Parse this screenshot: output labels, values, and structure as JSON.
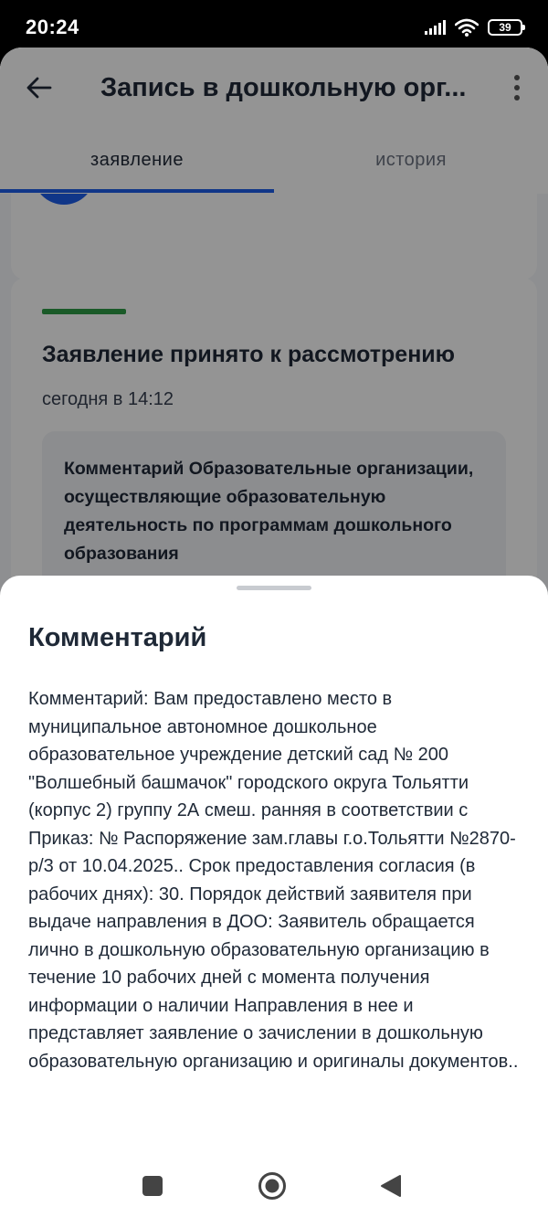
{
  "status_bar": {
    "time": "20:24",
    "battery": "39",
    "icons": [
      "signal-icon",
      "wifi-icon",
      "battery-icon"
    ]
  },
  "app": {
    "title": "Запись в дошкольную орг...",
    "tabs": [
      {
        "label": "заявление",
        "active": true
      },
      {
        "label": "история",
        "active": false
      }
    ],
    "accent_color": "#1d5deb",
    "status_card": {
      "heading": "Заявление принято к рассмотрению",
      "time": "сегодня в 14:12",
      "status_color": "#2e9b46",
      "comment_preview": "Комментарий Образовательные организации, осуществляющие образовательную деятельность по программам дошкольного образования"
    }
  },
  "sheet": {
    "title": "Комментарий",
    "body": "Комментарий: Вам предоставлено место в муниципальное автономное дошкольное образовательное учреждение детский сад № 200 \"Волшебный башмачок\" городского округа Тольятти (корпус 2) группу 2А смеш. ранняя в соответствии с Приказ: № Распоряжение зам.главы г.о.Тольятти №2870-р/3 от 10.04.2025.. Срок предоставления согласия (в рабочих днях): 30. Порядок действий заявителя при выдаче направления в ДОО: Заявитель обращается лично в дошкольную образовательную организацию в течение 10 рабочих дней с момента получения информации о наличии Направления в нее и представляет заявление о зачислении в дошкольную образовательную организацию и оригиналы документов.."
  },
  "navbar": {
    "icons": [
      "recents-square-icon",
      "home-circle-icon",
      "back-triangle-icon"
    ]
  }
}
